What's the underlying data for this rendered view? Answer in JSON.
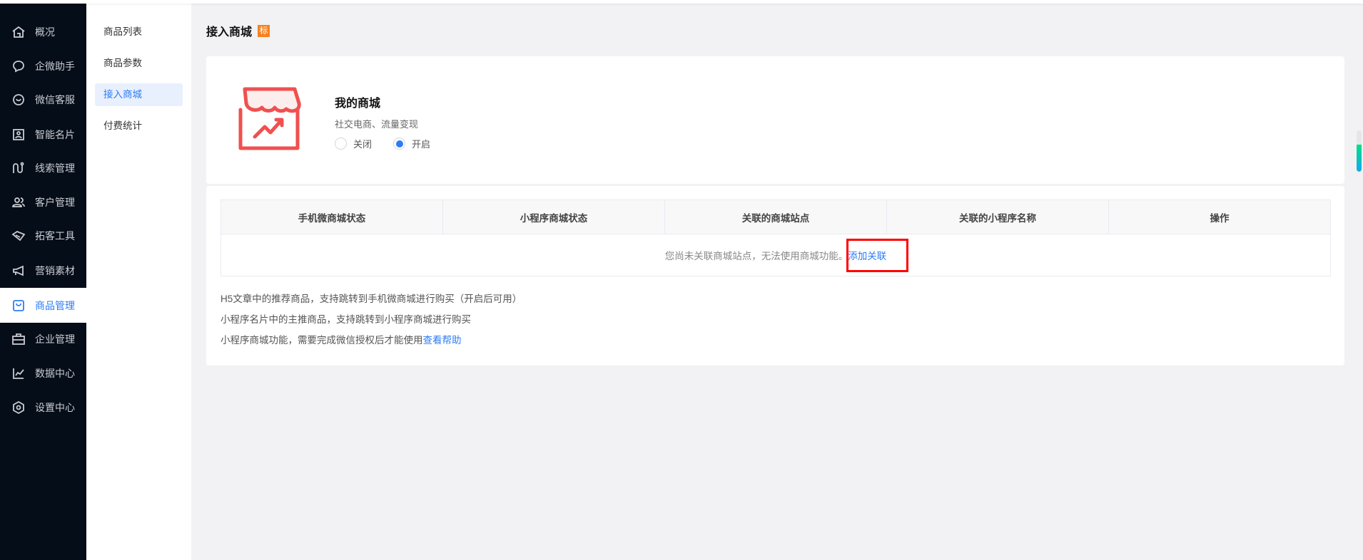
{
  "sidebar": {
    "items": [
      {
        "label": "概况",
        "icon": "home-icon"
      },
      {
        "label": "企微助手",
        "icon": "chat-icon"
      },
      {
        "label": "微信客服",
        "icon": "service-icon"
      },
      {
        "label": "智能名片",
        "icon": "card-icon"
      },
      {
        "label": "线索管理",
        "icon": "lead-icon"
      },
      {
        "label": "客户管理",
        "icon": "users-icon"
      },
      {
        "label": "拓客工具",
        "icon": "handshake-icon"
      },
      {
        "label": "营销素材",
        "icon": "megaphone-icon"
      },
      {
        "label": "商品管理",
        "icon": "bag-icon",
        "active": true
      },
      {
        "label": "企业管理",
        "icon": "briefcase-icon"
      },
      {
        "label": "数据中心",
        "icon": "chart-icon"
      },
      {
        "label": "设置中心",
        "icon": "settings-icon"
      }
    ]
  },
  "subnav": {
    "items": [
      {
        "label": "商品列表"
      },
      {
        "label": "商品参数"
      },
      {
        "label": "接入商城",
        "active": true
      },
      {
        "label": "付费统计"
      }
    ]
  },
  "page": {
    "title": "接入商城",
    "badge": "标"
  },
  "shop": {
    "title": "我的商城",
    "subtitle": "社交电商、流量变现",
    "radio_off": "关闭",
    "radio_on": "开启",
    "selected": "开启"
  },
  "table": {
    "headers": [
      "手机微商城状态",
      "小程序商城状态",
      "关联的商城站点",
      "关联的小程序名称",
      "操作"
    ],
    "empty_text": "您尚未关联商城站点，无法使用商城功能。",
    "empty_link": "添加关联"
  },
  "notes": {
    "line1": "H5文章中的推荐商品，支持跳转到手机微商城进行购买（开启后可用）",
    "line2": "小程序名片中的主推商品，支持跳转到小程序商城进行购买",
    "line3": "小程序商城功能，需要完成微信授权后才能使用",
    "help_link": "查看帮助"
  },
  "colors": {
    "accent": "#2d7cf6",
    "sidebar_bg": "#050d18",
    "badge": "#f58220",
    "icon_red": "#f05050"
  }
}
